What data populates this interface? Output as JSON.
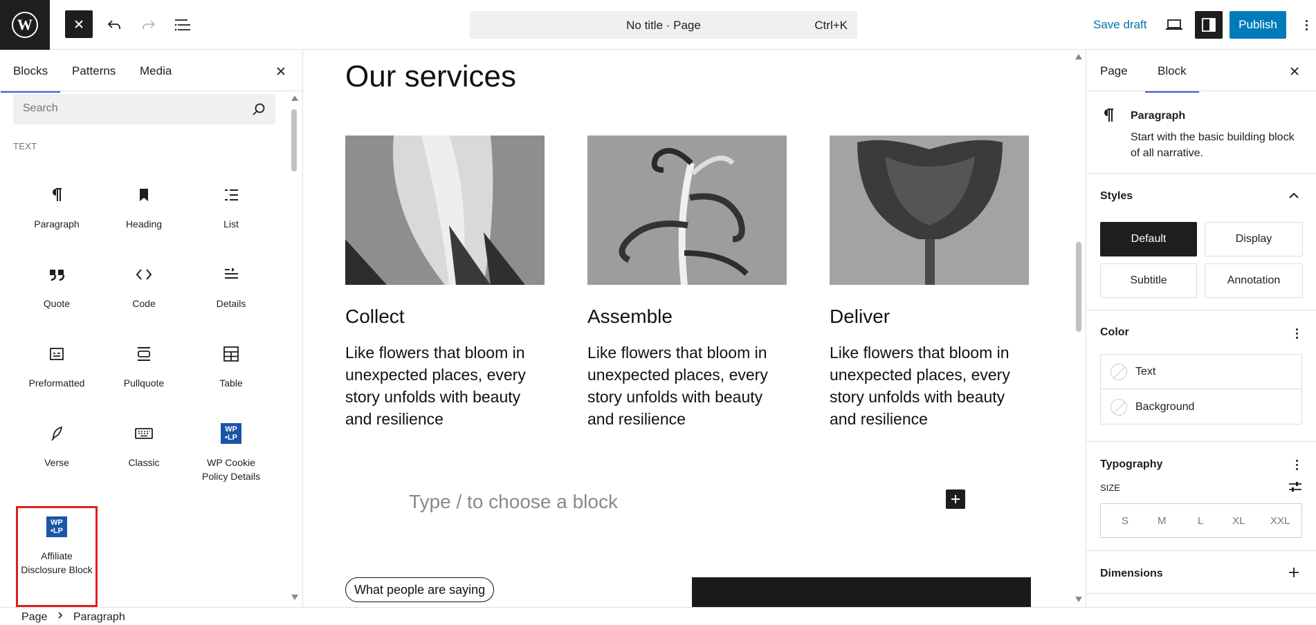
{
  "topbar": {
    "document_title": "No title · Page",
    "shortcut": "Ctrl+K",
    "save_draft": "Save draft",
    "publish": "Publish"
  },
  "inserter": {
    "tabs": [
      "Blocks",
      "Patterns",
      "Media"
    ],
    "search_placeholder": "Search",
    "category": "TEXT",
    "blocks": [
      {
        "label": "Paragraph",
        "icon": "paragraph-icon"
      },
      {
        "label": "Heading",
        "icon": "heading-icon"
      },
      {
        "label": "List",
        "icon": "list-icon"
      },
      {
        "label": "Quote",
        "icon": "quote-icon"
      },
      {
        "label": "Code",
        "icon": "code-icon"
      },
      {
        "label": "Details",
        "icon": "details-icon"
      },
      {
        "label": "Preformatted",
        "icon": "preformatted-icon"
      },
      {
        "label": "Pullquote",
        "icon": "pullquote-icon"
      },
      {
        "label": "Table",
        "icon": "table-icon"
      },
      {
        "label": "Verse",
        "icon": "verse-icon"
      },
      {
        "label": "Classic",
        "icon": "classic-icon"
      },
      {
        "label": "WP Cookie Policy Details",
        "icon": "wplp-icon"
      },
      {
        "label": "Affiliate Disclosure Block",
        "icon": "wplp-icon"
      }
    ]
  },
  "canvas": {
    "heading": "Our services",
    "services": [
      {
        "title": "Collect",
        "text": "Like flowers that bloom in unexpected places, every story unfolds with beauty and resilience"
      },
      {
        "title": "Assemble",
        "text": "Like flowers that bloom in unexpected places, every story unfolds with beauty and resilience"
      },
      {
        "title": "Deliver",
        "text": "Like flowers that bloom in unexpected places, every story unfolds with beauty and resilience"
      }
    ],
    "block_placeholder": "Type / to choose a block",
    "pill": "What people are saying"
  },
  "settings": {
    "tabs": [
      "Page",
      "Block"
    ],
    "block_name": "Paragraph",
    "block_description": "Start with the basic building block of all narrative.",
    "styles_title": "Styles",
    "styles": [
      "Default",
      "Display",
      "Subtitle",
      "Annotation"
    ],
    "color_title": "Color",
    "color_items": [
      "Text",
      "Background"
    ],
    "typography_title": "Typography",
    "size_label": "SIZE",
    "sizes": [
      "S",
      "M",
      "L",
      "XL",
      "XXL"
    ],
    "dimensions_title": "Dimensions"
  },
  "breadcrumb": [
    "Page",
    "Paragraph"
  ],
  "colors": {
    "accent": "#3858e9",
    "publish": "#007cba",
    "highlight": "#e11d1d",
    "plugin_icon": "#1a55a8"
  }
}
